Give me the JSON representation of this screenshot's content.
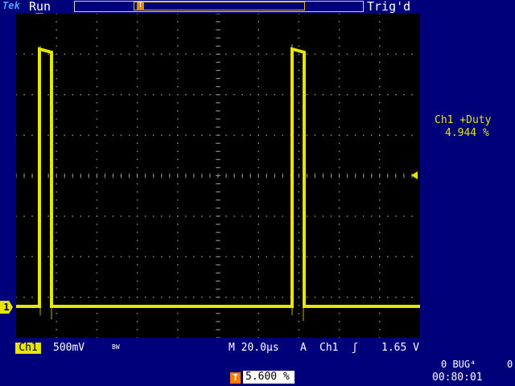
{
  "header": {
    "brand": "Tek",
    "run_state": "Run",
    "trigger_state": "Trig'd"
  },
  "trigger_marker": "T",
  "channel_marker": "1",
  "measurement": {
    "name": "Ch1 +Duty",
    "value": "4.944 %"
  },
  "status": {
    "channel": "Ch1",
    "volts_per_div": "500mV",
    "bandwidth_limit": "BW",
    "timebase": "M 20.0µs",
    "trigger_mode": "A",
    "trigger_source": "Ch1",
    "trigger_edge_symbol": "ʃ",
    "trigger_level": "1.65 V"
  },
  "horizontal_position": {
    "marker": "T",
    "value": "5.600 %"
  },
  "footer": {
    "bug_label": "0 BUG⁴",
    "bug_right": "0",
    "clock": "00:80:01"
  },
  "colors": {
    "trace": "#e6e600",
    "background": "#00007a",
    "screen": "#000000",
    "trigger_marker": "#ff7a00"
  }
}
